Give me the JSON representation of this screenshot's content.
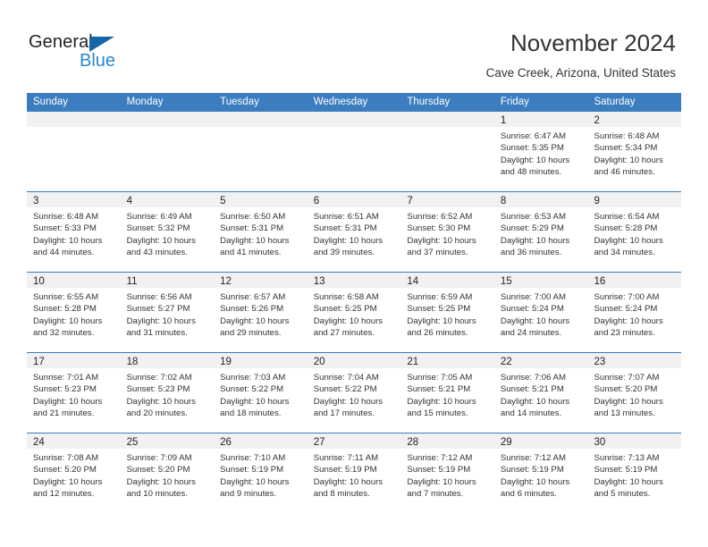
{
  "brand": {
    "name_part1": "General",
    "name_part2": "Blue",
    "triangle_color": "#1565a8",
    "blue_color": "#2a87d0"
  },
  "header": {
    "title": "November 2024",
    "subtitle": "Cave Creek, Arizona, United States"
  },
  "theme": {
    "header_blue": "#3b7dbf",
    "daynum_band": "#f1f1f1",
    "text": "#333333"
  },
  "calendar": {
    "day_names": [
      "Sunday",
      "Monday",
      "Tuesday",
      "Wednesday",
      "Thursday",
      "Friday",
      "Saturday"
    ],
    "weeks": [
      [
        {
          "day": "",
          "lines": []
        },
        {
          "day": "",
          "lines": []
        },
        {
          "day": "",
          "lines": []
        },
        {
          "day": "",
          "lines": []
        },
        {
          "day": "",
          "lines": []
        },
        {
          "day": "1",
          "lines": [
            "Sunrise: 6:47 AM",
            "Sunset: 5:35 PM",
            "Daylight: 10 hours",
            "and 48 minutes."
          ]
        },
        {
          "day": "2",
          "lines": [
            "Sunrise: 6:48 AM",
            "Sunset: 5:34 PM",
            "Daylight: 10 hours",
            "and 46 minutes."
          ]
        }
      ],
      [
        {
          "day": "3",
          "lines": [
            "Sunrise: 6:48 AM",
            "Sunset: 5:33 PM",
            "Daylight: 10 hours",
            "and 44 minutes."
          ]
        },
        {
          "day": "4",
          "lines": [
            "Sunrise: 6:49 AM",
            "Sunset: 5:32 PM",
            "Daylight: 10 hours",
            "and 43 minutes."
          ]
        },
        {
          "day": "5",
          "lines": [
            "Sunrise: 6:50 AM",
            "Sunset: 5:31 PM",
            "Daylight: 10 hours",
            "and 41 minutes."
          ]
        },
        {
          "day": "6",
          "lines": [
            "Sunrise: 6:51 AM",
            "Sunset: 5:31 PM",
            "Daylight: 10 hours",
            "and 39 minutes."
          ]
        },
        {
          "day": "7",
          "lines": [
            "Sunrise: 6:52 AM",
            "Sunset: 5:30 PM",
            "Daylight: 10 hours",
            "and 37 minutes."
          ]
        },
        {
          "day": "8",
          "lines": [
            "Sunrise: 6:53 AM",
            "Sunset: 5:29 PM",
            "Daylight: 10 hours",
            "and 36 minutes."
          ]
        },
        {
          "day": "9",
          "lines": [
            "Sunrise: 6:54 AM",
            "Sunset: 5:28 PM",
            "Daylight: 10 hours",
            "and 34 minutes."
          ]
        }
      ],
      [
        {
          "day": "10",
          "lines": [
            "Sunrise: 6:55 AM",
            "Sunset: 5:28 PM",
            "Daylight: 10 hours",
            "and 32 minutes."
          ]
        },
        {
          "day": "11",
          "lines": [
            "Sunrise: 6:56 AM",
            "Sunset: 5:27 PM",
            "Daylight: 10 hours",
            "and 31 minutes."
          ]
        },
        {
          "day": "12",
          "lines": [
            "Sunrise: 6:57 AM",
            "Sunset: 5:26 PM",
            "Daylight: 10 hours",
            "and 29 minutes."
          ]
        },
        {
          "day": "13",
          "lines": [
            "Sunrise: 6:58 AM",
            "Sunset: 5:25 PM",
            "Daylight: 10 hours",
            "and 27 minutes."
          ]
        },
        {
          "day": "14",
          "lines": [
            "Sunrise: 6:59 AM",
            "Sunset: 5:25 PM",
            "Daylight: 10 hours",
            "and 26 minutes."
          ]
        },
        {
          "day": "15",
          "lines": [
            "Sunrise: 7:00 AM",
            "Sunset: 5:24 PM",
            "Daylight: 10 hours",
            "and 24 minutes."
          ]
        },
        {
          "day": "16",
          "lines": [
            "Sunrise: 7:00 AM",
            "Sunset: 5:24 PM",
            "Daylight: 10 hours",
            "and 23 minutes."
          ]
        }
      ],
      [
        {
          "day": "17",
          "lines": [
            "Sunrise: 7:01 AM",
            "Sunset: 5:23 PM",
            "Daylight: 10 hours",
            "and 21 minutes."
          ]
        },
        {
          "day": "18",
          "lines": [
            "Sunrise: 7:02 AM",
            "Sunset: 5:23 PM",
            "Daylight: 10 hours",
            "and 20 minutes."
          ]
        },
        {
          "day": "19",
          "lines": [
            "Sunrise: 7:03 AM",
            "Sunset: 5:22 PM",
            "Daylight: 10 hours",
            "and 18 minutes."
          ]
        },
        {
          "day": "20",
          "lines": [
            "Sunrise: 7:04 AM",
            "Sunset: 5:22 PM",
            "Daylight: 10 hours",
            "and 17 minutes."
          ]
        },
        {
          "day": "21",
          "lines": [
            "Sunrise: 7:05 AM",
            "Sunset: 5:21 PM",
            "Daylight: 10 hours",
            "and 15 minutes."
          ]
        },
        {
          "day": "22",
          "lines": [
            "Sunrise: 7:06 AM",
            "Sunset: 5:21 PM",
            "Daylight: 10 hours",
            "and 14 minutes."
          ]
        },
        {
          "day": "23",
          "lines": [
            "Sunrise: 7:07 AM",
            "Sunset: 5:20 PM",
            "Daylight: 10 hours",
            "and 13 minutes."
          ]
        }
      ],
      [
        {
          "day": "24",
          "lines": [
            "Sunrise: 7:08 AM",
            "Sunset: 5:20 PM",
            "Daylight: 10 hours",
            "and 12 minutes."
          ]
        },
        {
          "day": "25",
          "lines": [
            "Sunrise: 7:09 AM",
            "Sunset: 5:20 PM",
            "Daylight: 10 hours",
            "and 10 minutes."
          ]
        },
        {
          "day": "26",
          "lines": [
            "Sunrise: 7:10 AM",
            "Sunset: 5:19 PM",
            "Daylight: 10 hours",
            "and 9 minutes."
          ]
        },
        {
          "day": "27",
          "lines": [
            "Sunrise: 7:11 AM",
            "Sunset: 5:19 PM",
            "Daylight: 10 hours",
            "and 8 minutes."
          ]
        },
        {
          "day": "28",
          "lines": [
            "Sunrise: 7:12 AM",
            "Sunset: 5:19 PM",
            "Daylight: 10 hours",
            "and 7 minutes."
          ]
        },
        {
          "day": "29",
          "lines": [
            "Sunrise: 7:12 AM",
            "Sunset: 5:19 PM",
            "Daylight: 10 hours",
            "and 6 minutes."
          ]
        },
        {
          "day": "30",
          "lines": [
            "Sunrise: 7:13 AM",
            "Sunset: 5:19 PM",
            "Daylight: 10 hours",
            "and 5 minutes."
          ]
        }
      ]
    ]
  }
}
